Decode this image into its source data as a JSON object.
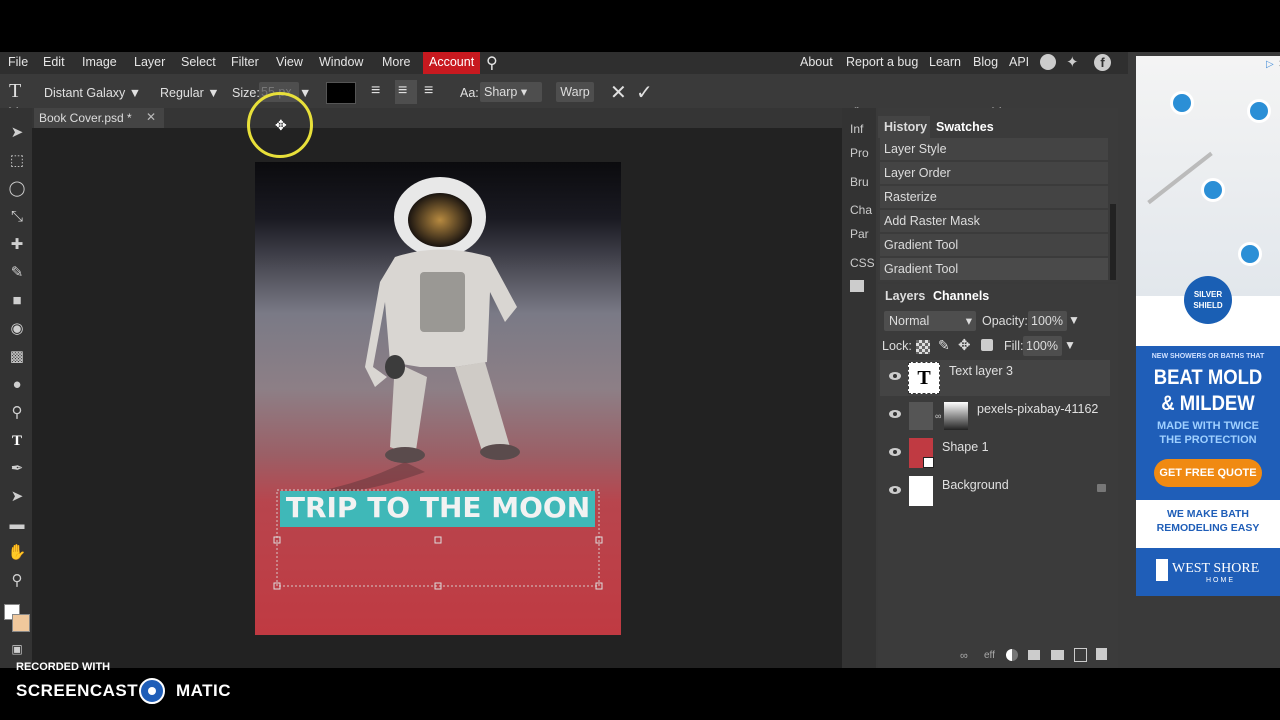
{
  "menu": {
    "items": [
      "File",
      "Edit",
      "Image",
      "Layer",
      "Select",
      "Filter",
      "View",
      "Window",
      "More"
    ],
    "account": "Account",
    "right": [
      "About",
      "Report a bug",
      "Learn",
      "Blog",
      "API"
    ]
  },
  "options": {
    "font": "Distant Galaxy",
    "style": "Regular",
    "size_label": "Size:",
    "size_value": "55 px",
    "aa_label": "Aa:",
    "aa_value": "Sharp",
    "warp": "Warp"
  },
  "document": {
    "tab": "Book Cover.psd *",
    "title_text": "TRIP TO THE MOON"
  },
  "mini_panels": [
    "Inf",
    "Pro",
    "Bru",
    "Cha",
    "Par",
    "CSS"
  ],
  "history": {
    "tabs": [
      "History",
      "Swatches"
    ],
    "items": [
      "Layer Style",
      "Layer Order",
      "Rasterize",
      "Add Raster Mask",
      "Gradient Tool",
      "Gradient Tool"
    ]
  },
  "layers": {
    "tabs": [
      "Layers",
      "Channels"
    ],
    "blend": "Normal",
    "opacity_label": "Opacity:",
    "opacity": "100%",
    "lock_label": "Lock:",
    "fill_label": "Fill:",
    "fill": "100%",
    "list": [
      "Text layer 3",
      "pexels-pixabay-41162",
      "Shape 1",
      "Background"
    ],
    "footer": "eff"
  },
  "ad": {
    "logo": "SILVER SHIELD",
    "tagline": "NEW SHOWERS OR BATHS THAT",
    "headline1": "BEAT MOLD",
    "headline2": "& MILDEW",
    "sub1": "MADE WITH TWICE",
    "sub2": "THE PROTECTION",
    "cta": "GET FREE QUOTE",
    "promo1": "WE MAKE BATH",
    "promo2": "REMODELING EASY",
    "brand": "WEST SHORE",
    "brand_sub": "HOME"
  },
  "watermark": {
    "recorded": "RECORDED WITH",
    "brand_left": "SCREENCAST",
    "brand_right": "MATIC"
  },
  "colors": {
    "accent": "#c8191f",
    "text_highlight": "#3fb8b8",
    "shape_red": "#c03a42"
  }
}
